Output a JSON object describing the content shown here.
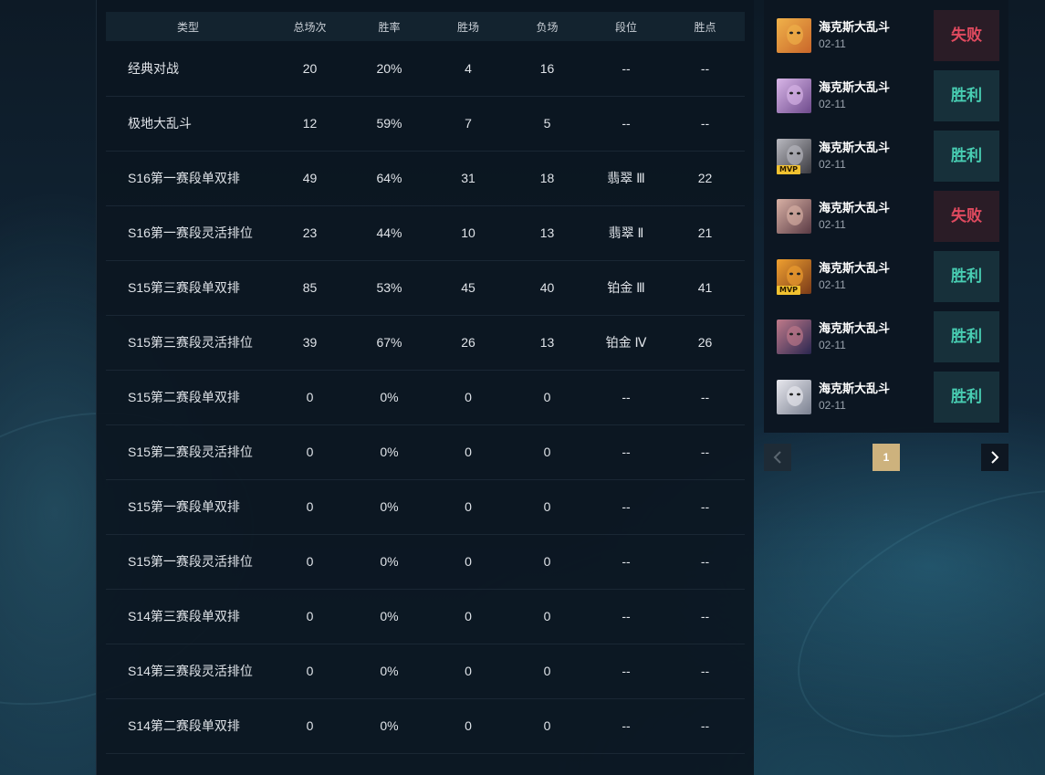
{
  "stats_table": {
    "headers": [
      "类型",
      "总场次",
      "胜率",
      "胜场",
      "负场",
      "段位",
      "胜点"
    ],
    "rows": [
      {
        "type": "经典对战",
        "total": "20",
        "win_rate": "20%",
        "wins": "4",
        "losses": "16",
        "rank": "--",
        "lp": "--"
      },
      {
        "type": "极地大乱斗",
        "total": "12",
        "win_rate": "59%",
        "wins": "7",
        "losses": "5",
        "rank": "--",
        "lp": "--"
      },
      {
        "type": "S16第一赛段单双排",
        "total": "49",
        "win_rate": "64%",
        "wins": "31",
        "losses": "18",
        "rank": "翡翠 Ⅲ",
        "lp": "22"
      },
      {
        "type": "S16第一赛段灵活排位",
        "total": "23",
        "win_rate": "44%",
        "wins": "10",
        "losses": "13",
        "rank": "翡翠 Ⅱ",
        "lp": "21"
      },
      {
        "type": "S15第三赛段单双排",
        "total": "85",
        "win_rate": "53%",
        "wins": "45",
        "losses": "40",
        "rank": "铂金 Ⅲ",
        "lp": "41"
      },
      {
        "type": "S15第三赛段灵活排位",
        "total": "39",
        "win_rate": "67%",
        "wins": "26",
        "losses": "13",
        "rank": "铂金 Ⅳ",
        "lp": "26"
      },
      {
        "type": "S15第二赛段单双排",
        "total": "0",
        "win_rate": "0%",
        "wins": "0",
        "losses": "0",
        "rank": "--",
        "lp": "--"
      },
      {
        "type": "S15第二赛段灵活排位",
        "total": "0",
        "win_rate": "0%",
        "wins": "0",
        "losses": "0",
        "rank": "--",
        "lp": "--"
      },
      {
        "type": "S15第一赛段单双排",
        "total": "0",
        "win_rate": "0%",
        "wins": "0",
        "losses": "0",
        "rank": "--",
        "lp": "--"
      },
      {
        "type": "S15第一赛段灵活排位",
        "total": "0",
        "win_rate": "0%",
        "wins": "0",
        "losses": "0",
        "rank": "--",
        "lp": "--"
      },
      {
        "type": "S14第三赛段单双排",
        "total": "0",
        "win_rate": "0%",
        "wins": "0",
        "losses": "0",
        "rank": "--",
        "lp": "--"
      },
      {
        "type": "S14第三赛段灵活排位",
        "total": "0",
        "win_rate": "0%",
        "wins": "0",
        "losses": "0",
        "rank": "--",
        "lp": "--"
      },
      {
        "type": "S14第二赛段单双排",
        "total": "0",
        "win_rate": "0%",
        "wins": "0",
        "losses": "0",
        "rank": "--",
        "lp": "--"
      }
    ]
  },
  "match_history": {
    "matches": [
      {
        "mode": "海克斯大乱斗",
        "date": "02-11",
        "result": "失败",
        "outcome": "lose",
        "mvp": false,
        "badge": "",
        "portrait_colors": [
          "#c9662a",
          "#f0b24a"
        ]
      },
      {
        "mode": "海克斯大乱斗",
        "date": "02-11",
        "result": "胜利",
        "outcome": "win",
        "mvp": false,
        "badge": "",
        "portrait_colors": [
          "#6e4a8c",
          "#d9b6e8"
        ]
      },
      {
        "mode": "海克斯大乱斗",
        "date": "02-11",
        "result": "胜利",
        "outcome": "win",
        "mvp": true,
        "badge": "MVP",
        "portrait_colors": [
          "#3a3a40",
          "#b9b9c0"
        ]
      },
      {
        "mode": "海克斯大乱斗",
        "date": "02-11",
        "result": "失败",
        "outcome": "lose",
        "mvp": false,
        "badge": "",
        "portrait_colors": [
          "#5a3a44",
          "#d8b0a4"
        ]
      },
      {
        "mode": "海克斯大乱斗",
        "date": "02-11",
        "result": "胜利",
        "outcome": "win",
        "mvp": true,
        "badge": "MVP",
        "portrait_colors": [
          "#7a3a18",
          "#f0a030"
        ]
      },
      {
        "mode": "海克斯大乱斗",
        "date": "02-11",
        "result": "胜利",
        "outcome": "win",
        "mvp": false,
        "badge": "",
        "portrait_colors": [
          "#2a2650",
          "#c07a8a"
        ]
      },
      {
        "mode": "海克斯大乱斗",
        "date": "02-11",
        "result": "胜利",
        "outcome": "win",
        "mvp": false,
        "badge": "",
        "portrait_colors": [
          "#7a8090",
          "#e8e8ee"
        ]
      }
    ]
  },
  "pagination": {
    "current_page": "1",
    "prev_icon": "chevron-left-icon",
    "next_icon": "chevron-right-icon"
  },
  "colors": {
    "win": "#48cdb2",
    "lose": "#e04a5f",
    "page_active": "#cdb27d"
  }
}
